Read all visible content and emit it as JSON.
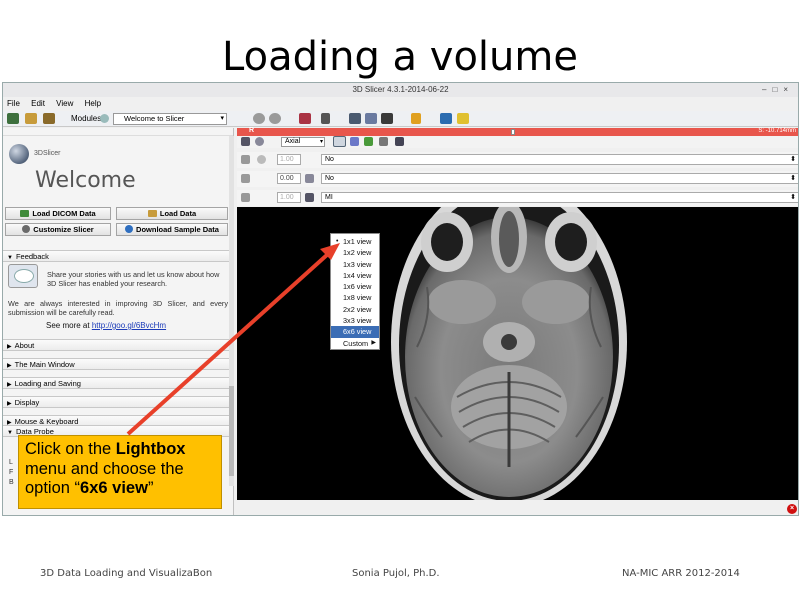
{
  "slide": {
    "title": "Loading a volume",
    "footer_left": "3D Data Loading and VisualizaBon",
    "footer_center": "Sonia Pujol, Ph.D.",
    "footer_right": "NA-MIC ARR 2012-2014"
  },
  "window": {
    "title": "3D Slicer 4.3.1-2014-06-22",
    "controls": "–□×"
  },
  "menubar": {
    "items": [
      "File",
      "Edit",
      "View",
      "Help"
    ]
  },
  "toolbar": {
    "modules_label": "Modules:",
    "module_value": "Welcome to Slicer"
  },
  "left_panel": {
    "brand": "3DSlicer",
    "welcome": "Welcome",
    "load_dicom": "Load DICOM Data",
    "load_data": "Load Data",
    "customize": "Customize Slicer",
    "download_sample": "Download Sample Data",
    "feedback_header": "Feedback",
    "feedback_text1": "Share your stories with us and let us know about how 3D Slicer has enabled your research.",
    "feedback_text2": "We are always interested in improving 3D Slicer, and every submission will be carefully read.",
    "see_more": "See more at",
    "see_more_link": "http://goo.gl/6BvcHm",
    "sections": [
      "About",
      "The Main Window",
      "Loading and Saving",
      "Display",
      "Mouse & Keyboard",
      "Data Probe"
    ],
    "probe_letters": [
      "L",
      "F",
      "B"
    ]
  },
  "callout": {
    "text_a": "Click on the ",
    "bold_a": "Lightbox",
    "text_b": " menu and choose the option “",
    "bold_b": "6x6 view",
    "text_c": "”"
  },
  "slice_view": {
    "red_label": "R",
    "slice_offset": "S: -10.714mm",
    "orientation": "Axial",
    "opacity1": "1.00",
    "opacity2": "0.00",
    "opacity3": "1.00",
    "row1_value": "No",
    "row2_value": "No",
    "row3_value": "MI"
  },
  "lightbox_menu": {
    "items": [
      "1x1 view",
      "1x2 view",
      "1x3 view",
      "1x4 view",
      "1x6 view",
      "1x8 view",
      "2x2 view",
      "3x3 view",
      "6x6 view",
      "Custom"
    ],
    "checked": "1x1 view",
    "selected": "6x6 view"
  },
  "colors": {
    "callout": "#ffc000",
    "red_slice": "#e8564c",
    "menu_highlight": "#3b6db5",
    "arrow": "#e8402a"
  },
  "icons": [
    "load-dicom-icon",
    "load-data-icon",
    "save-icon",
    "back-arrow-icon",
    "forward-arrow-icon",
    "layout-icon",
    "mouse-mode-icon",
    "crosshair-icon",
    "python-icon",
    "extension-manager-icon",
    "pin-icon",
    "link-icon",
    "error-icon"
  ]
}
